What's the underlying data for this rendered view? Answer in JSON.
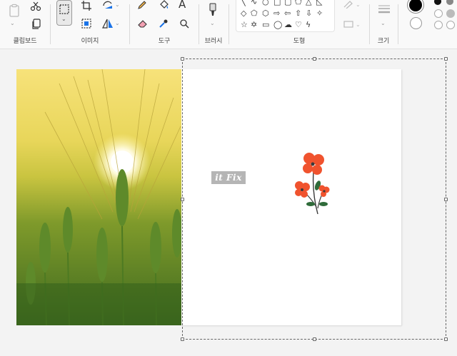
{
  "ribbon": {
    "groups": {
      "clipboard": "클립보드",
      "image": "이미지",
      "tools": "도구",
      "brush": "브러시",
      "shapes": "도형",
      "size": "크기"
    }
  },
  "canvas": {
    "watermark_text": "it Fix"
  },
  "icons": {
    "clipboard": [
      "paste-icon",
      "cut-icon",
      "copy-icon"
    ],
    "image": [
      "select-icon",
      "crop-icon",
      "rotate-icon",
      "resize-icon",
      "flip-icon"
    ],
    "tools": [
      "pencil-icon",
      "fill-icon",
      "text-icon",
      "eraser-icon",
      "color-picker-icon",
      "magnifier-icon"
    ],
    "shapes_colors": [
      "shape-outline-icon",
      "shape-fill-icon"
    ]
  },
  "colors": {
    "accent": "#1a73e8",
    "flower": "#f0532e",
    "stem": "#2f6b3a",
    "selected_color": "#000000"
  }
}
